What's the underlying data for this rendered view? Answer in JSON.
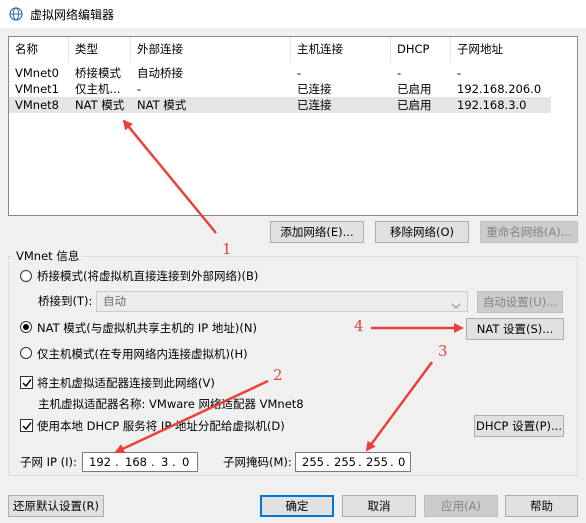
{
  "window": {
    "title": "虚拟网络编辑器",
    "icon": "vmware-network-icon"
  },
  "table": {
    "columns": [
      "名称",
      "类型",
      "外部连接",
      "主机连接",
      "DHCP",
      "子网地址"
    ],
    "rows": [
      {
        "name": "VMnet0",
        "type": "桥接模式",
        "external": "自动桥接",
        "host": "-",
        "dhcp": "-",
        "subnet": "-"
      },
      {
        "name": "VMnet1",
        "type": "仅主机...",
        "external": "-",
        "host": "已连接",
        "dhcp": "已启用",
        "subnet": "192.168.206.0"
      },
      {
        "name": "VMnet8",
        "type": "NAT 模式",
        "external": "NAT 模式",
        "host": "已连接",
        "dhcp": "已启用",
        "subnet": "192.168.3.0"
      }
    ],
    "selected_row": 2
  },
  "table_buttons": {
    "add": "添加网络(E)...",
    "remove": "移除网络(O)",
    "rename": "重命名网络(A)..."
  },
  "vmnet_info": {
    "group_title": "VMnet 信息",
    "bridge_radio": "桥接模式(将虚拟机直接连接到外部网络)(B)",
    "bridge_to_label": "桥接到(T):",
    "bridge_to_value": "自动",
    "auto_settings": "自动设置(U)...",
    "nat_radio": "NAT 模式(与虚拟机共享主机的 IP 地址)(N)",
    "nat_settings": "NAT 设置(S)...",
    "hostonly_radio": "仅主机模式(在专用网络内连接虚拟机)(H)",
    "selected_mode": "nat",
    "connect_adapter": "将主机虚拟适配器连接到此网络(V)",
    "adapter_name": "主机虚拟适配器名称: VMware 网络适配器 VMnet8",
    "use_dhcp": "使用本地 DHCP 服务将 IP 地址分配给虚拟机(D)",
    "dhcp_settings": "DHCP 设置(P)...",
    "subnet_ip_label": "子网 IP (I):",
    "subnet_ip": [
      "192",
      "168",
      "3",
      "0"
    ],
    "subnet_mask_label": "子网掩码(M):",
    "subnet_mask": [
      "255",
      "255",
      "255",
      "0"
    ]
  },
  "bottom_buttons": {
    "restore": "还原默认设置(R)",
    "ok": "确定",
    "cancel": "取消",
    "apply": "应用(A)",
    "help": "帮助"
  },
  "annotations": [
    "1",
    "2",
    "3",
    "4"
  ],
  "colors": {
    "annotation": "#e8413b",
    "accent": "#0078d7",
    "selected_row": "#e5e5e5"
  }
}
